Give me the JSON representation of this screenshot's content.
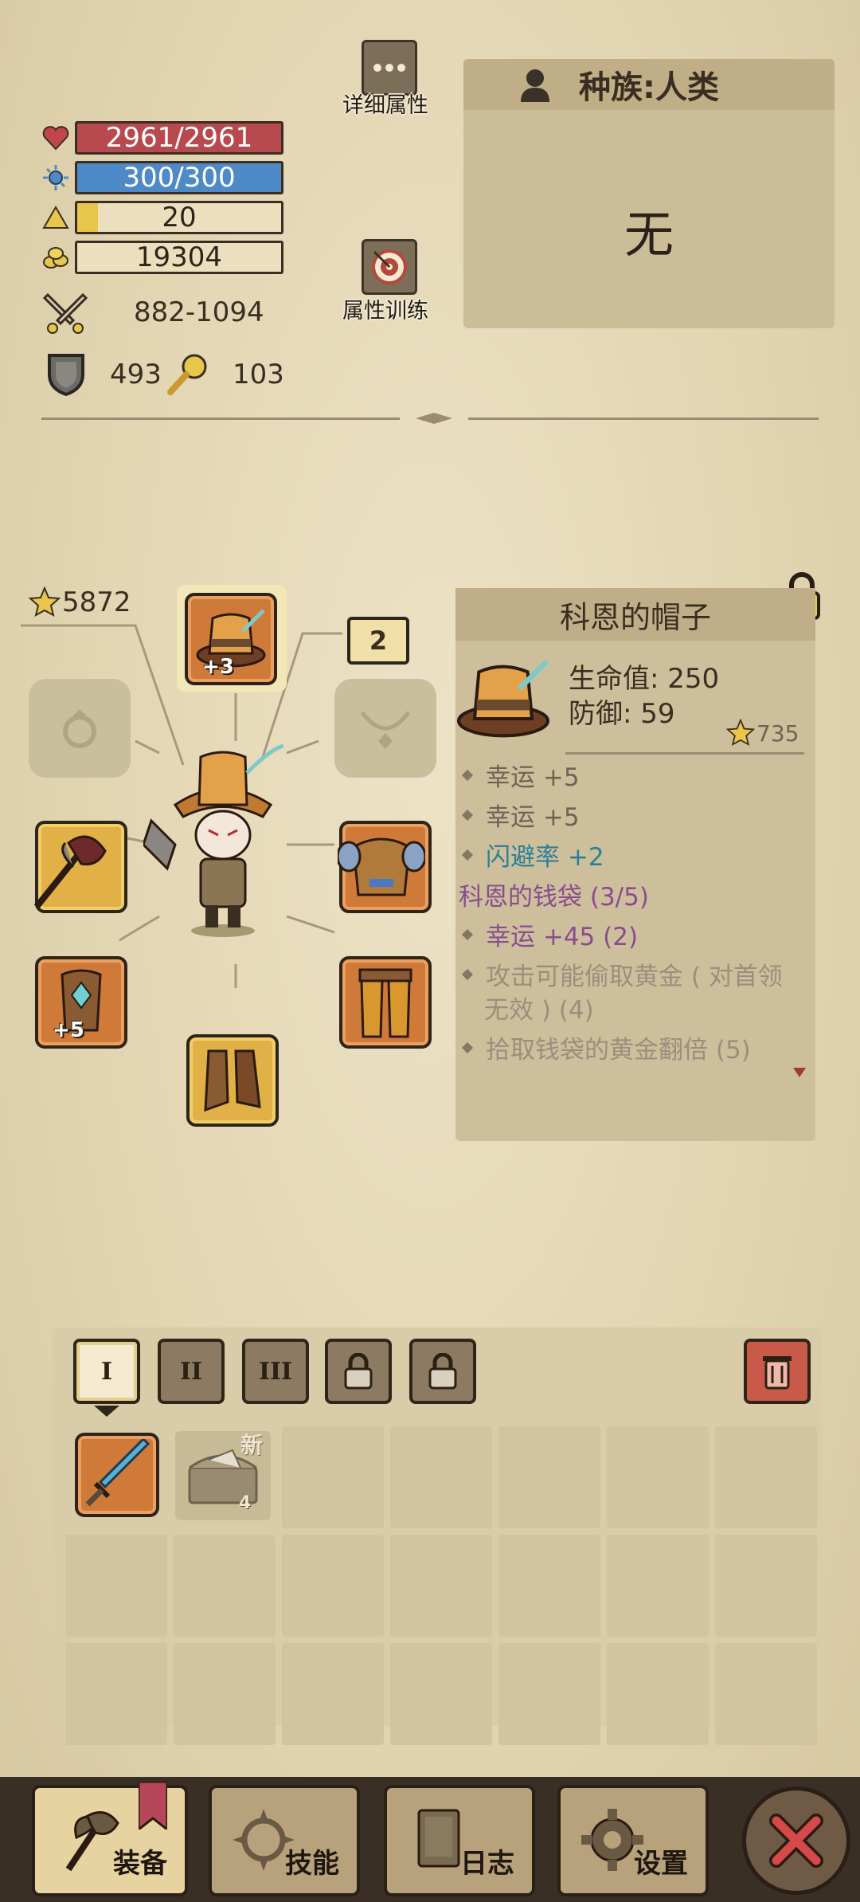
{
  "stats": {
    "hp": "2961/2961",
    "mp": "300/300",
    "level": "20",
    "level_progress": 0.1,
    "gold": "19304",
    "attack": "882-1094",
    "defense": "493",
    "luck": "103"
  },
  "buttons": {
    "detail_attrs": "详细属性",
    "attr_training": "属性训练"
  },
  "race": {
    "title": "种族:人类",
    "value": "无"
  },
  "equipment": {
    "score": "5872",
    "next_level": "2",
    "helmet_plus": "+3",
    "boots_plus": "+5"
  },
  "item": {
    "name": "科恩的帽子",
    "hp": "生命值: 250",
    "def": "防御: 59",
    "score": "735",
    "lines": [
      {
        "text": "幸运 +5",
        "class": "c-gray"
      },
      {
        "text": "幸运 +5",
        "class": "c-gray"
      },
      {
        "text": "闪避率 +2",
        "class": "c-teal"
      }
    ],
    "set_name": "科恩的钱袋 (3/5)",
    "set_bonus_1": "幸运 +45 (2)",
    "set_bonus_2a": "攻击可能偷取黄金 ( 对首领",
    "set_bonus_2b": "无效 ) (4)",
    "set_bonus_3": "拾取钱袋的黄金翻倍 (5)"
  },
  "inventory": {
    "tabs": [
      "I",
      "II",
      "III"
    ],
    "new_badge": "新",
    "chest_count": "4"
  },
  "nav": {
    "equip": "装备",
    "skills": "技能",
    "log": "日志",
    "settings": "设置"
  },
  "colors": {
    "hp_bar": "#b84a4f",
    "mp_bar": "#4e8ac8",
    "teal_text": "#2d7f96",
    "purple_text": "#8a4c91"
  }
}
